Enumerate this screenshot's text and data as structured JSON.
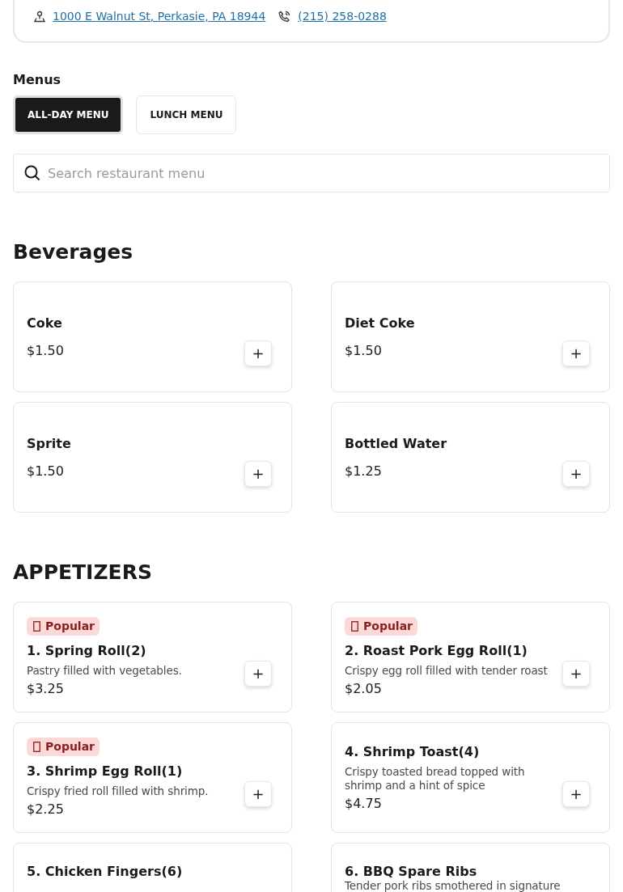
{
  "location": {
    "address": "1000 E Walnut St, Perkasie, PA 18944",
    "phone": "(215) 258-0288"
  },
  "menus": {
    "title": "Menus",
    "tabs": [
      {
        "label": "ALL-DAY MENU",
        "selected": true
      },
      {
        "label": "LUNCH MENU",
        "selected": false
      }
    ]
  },
  "search": {
    "placeholder": "Search restaurant menu"
  },
  "sections": [
    {
      "title": "Beverages",
      "items": [
        {
          "name": "Coke",
          "price": "$1.50",
          "add": "+"
        },
        {
          "name": "Diet Coke",
          "price": "$1.50",
          "add": "+"
        },
        {
          "name": "Sprite",
          "price": "$1.50",
          "add": "+"
        },
        {
          "name": "Bottled Water",
          "price": "$1.25",
          "add": "+"
        }
      ]
    },
    {
      "title": "APPETIZERS",
      "items": [
        {
          "badge": "Popular",
          "name": "1. Spring Roll(2)",
          "description": "Pastry filled with vegetables.",
          "price": "$3.25",
          "add": "+"
        },
        {
          "badge": "Popular",
          "name": "2. Roast Pork Egg Roll(1)",
          "description": "Crispy egg roll filled with tender roast",
          "price": "$2.05",
          "add": "+"
        },
        {
          "badge": "Popular",
          "name": "3. Shrimp Egg Roll(1)",
          "description": "Crispy fried roll filled with shrimp.",
          "price": "$2.25",
          "add": "+"
        },
        {
          "name": "4. Shrimp Toast(4)",
          "description": "Crispy toasted bread topped with shrimp and a hint of spice",
          "price": "$4.75",
          "add": "+"
        },
        {
          "name": "5. Chicken Fingers(6)"
        },
        {
          "name": "6. BBQ Spare Ribs",
          "description": "Tender pork ribs smothered in signature"
        }
      ]
    }
  ]
}
